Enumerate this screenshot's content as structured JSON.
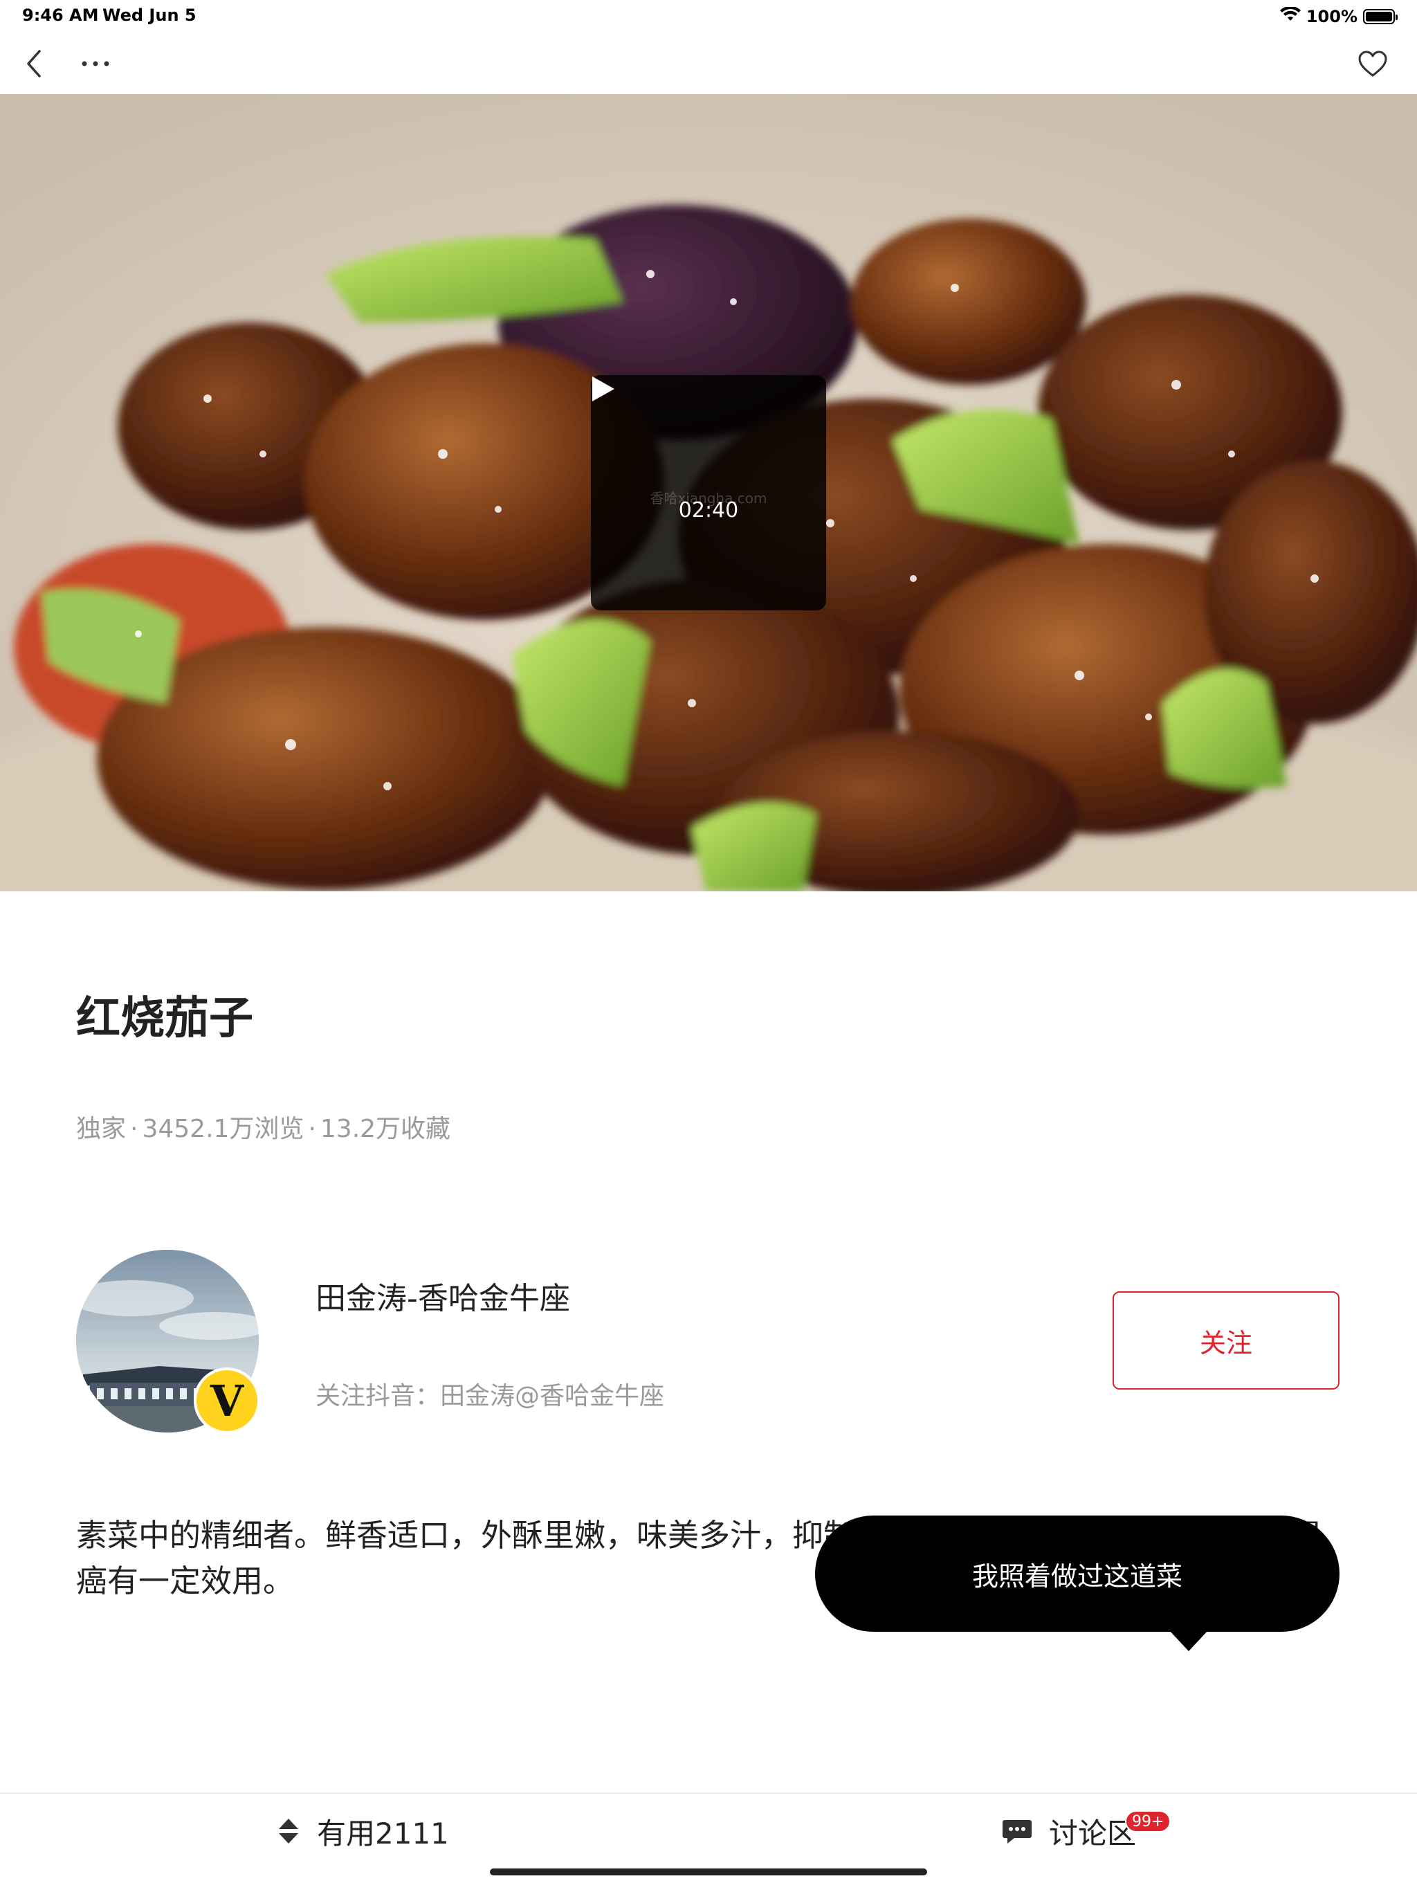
{
  "status_bar": {
    "time": "9:46 AM",
    "date": "Wed Jun 5",
    "battery_percent": "100%",
    "battery_level": 1.0,
    "icons": [
      "wifi-icon",
      "battery-icon"
    ]
  },
  "nav": {
    "icons": [
      "back-icon",
      "more-icon",
      "favorite-heart-icon"
    ]
  },
  "video": {
    "duration": "02:40",
    "watermark": "香哈xiangha.com",
    "icon": "play-icon"
  },
  "recipe": {
    "title": "红烧茄子",
    "meta": {
      "tag": "独家",
      "views": "3452.1万浏览",
      "favorites": "13.2万收藏",
      "separator": "·"
    },
    "description": "素菜中的精细者。鲜香适口，外酥里嫩，味美多汁，抑制消化系统肿瘤的增殖，对于防治胃癌有一定效用。"
  },
  "author": {
    "name": "田金涛-香哈金牛座",
    "subtitle": "关注抖音：田金涛@香哈金牛座",
    "badge": "V",
    "follow_label": "关注"
  },
  "tooltip": {
    "text": "我照着做过这道菜"
  },
  "bottom_bar": {
    "useful_label": "有用2111",
    "discuss_label": "讨论区",
    "discuss_badge": "99+",
    "icons": [
      "vote-arrows-icon",
      "comment-icon"
    ]
  },
  "colors": {
    "accent_red": "#e0242d",
    "meta_gray": "#9a9a9a",
    "text_dark": "#222222",
    "tooltip_bg": "#000000"
  }
}
